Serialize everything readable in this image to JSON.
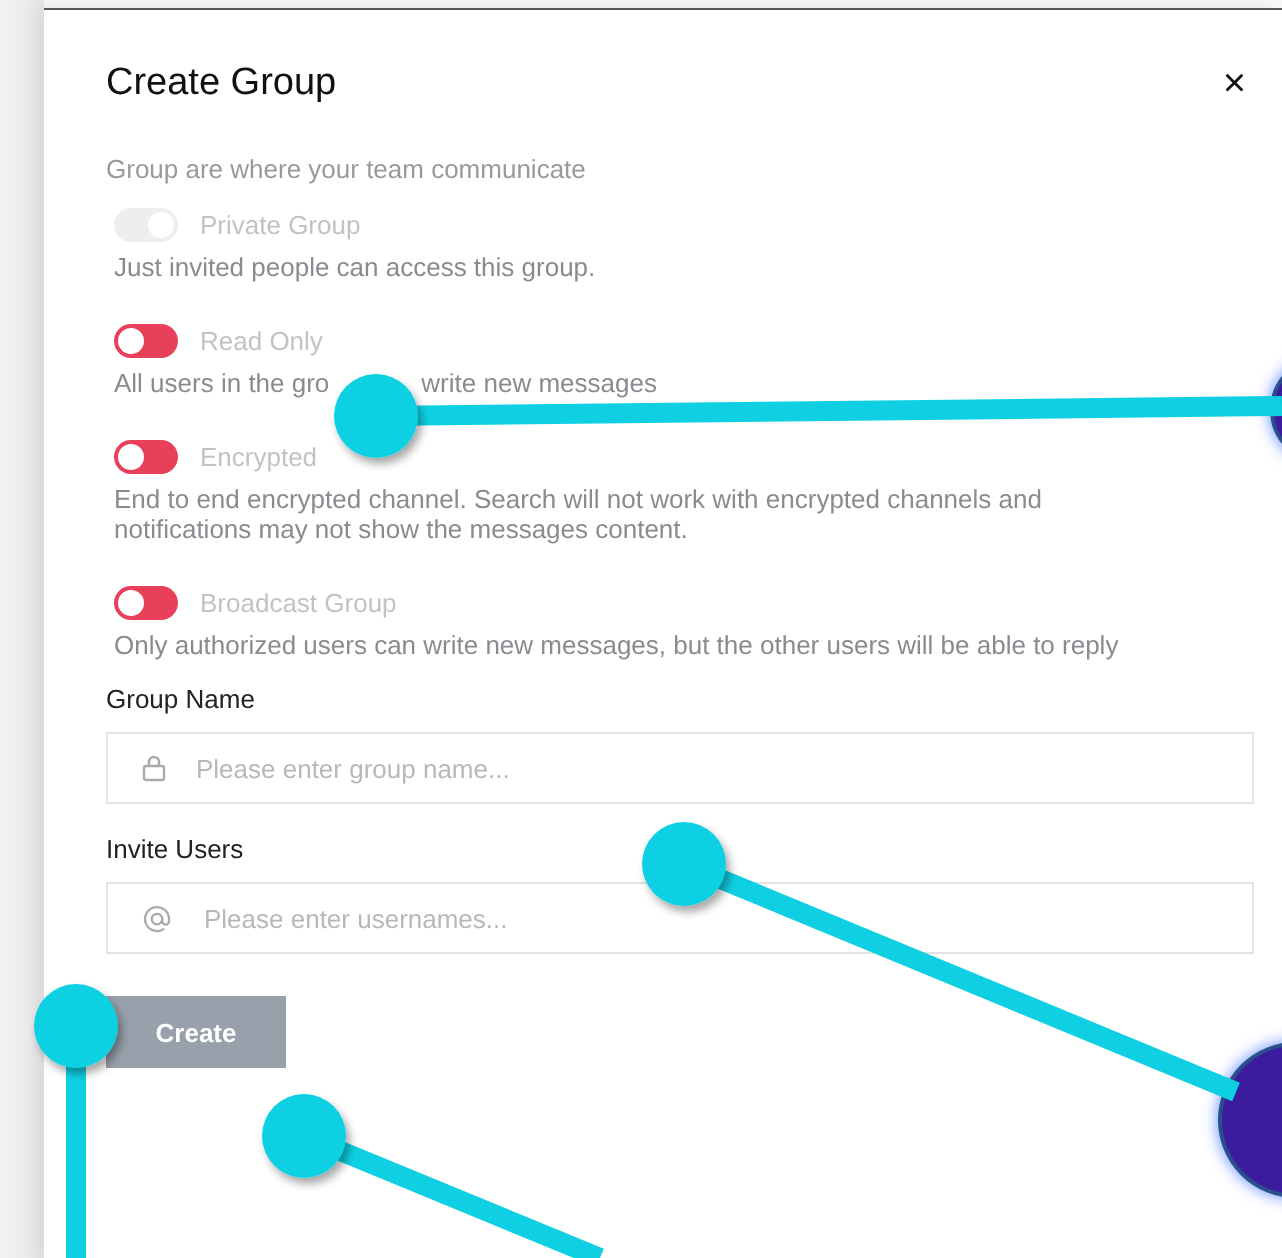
{
  "dialog": {
    "title": "Create Group",
    "close": "×",
    "intro": "Group are where your team communicate",
    "options": [
      {
        "label": "Private Group",
        "on": true,
        "disabled": true,
        "description": [
          "Just invited people can access this group."
        ]
      },
      {
        "label": "Read Only",
        "on": false,
        "disabled": false,
        "description": [
          "All users in the gro",
          "write new messages"
        ]
      },
      {
        "label": "Encrypted",
        "on": false,
        "disabled": false,
        "description": [
          "End to end encrypted channel. Search will not work with encrypted channels and notifications may not show the messages content."
        ]
      },
      {
        "label": "Broadcast Group",
        "on": false,
        "disabled": false,
        "description": [
          "Only authorized users can write new messages, but the other users will be able to reply"
        ]
      }
    ],
    "fields": [
      {
        "kind": "lock",
        "label": "Group Name",
        "placeholder": "Please enter group name..."
      },
      {
        "kind": "at",
        "label": "Invite Users",
        "placeholder": "Please enter usernames..."
      }
    ],
    "button": {
      "label": "Create",
      "disabled": true
    }
  }
}
